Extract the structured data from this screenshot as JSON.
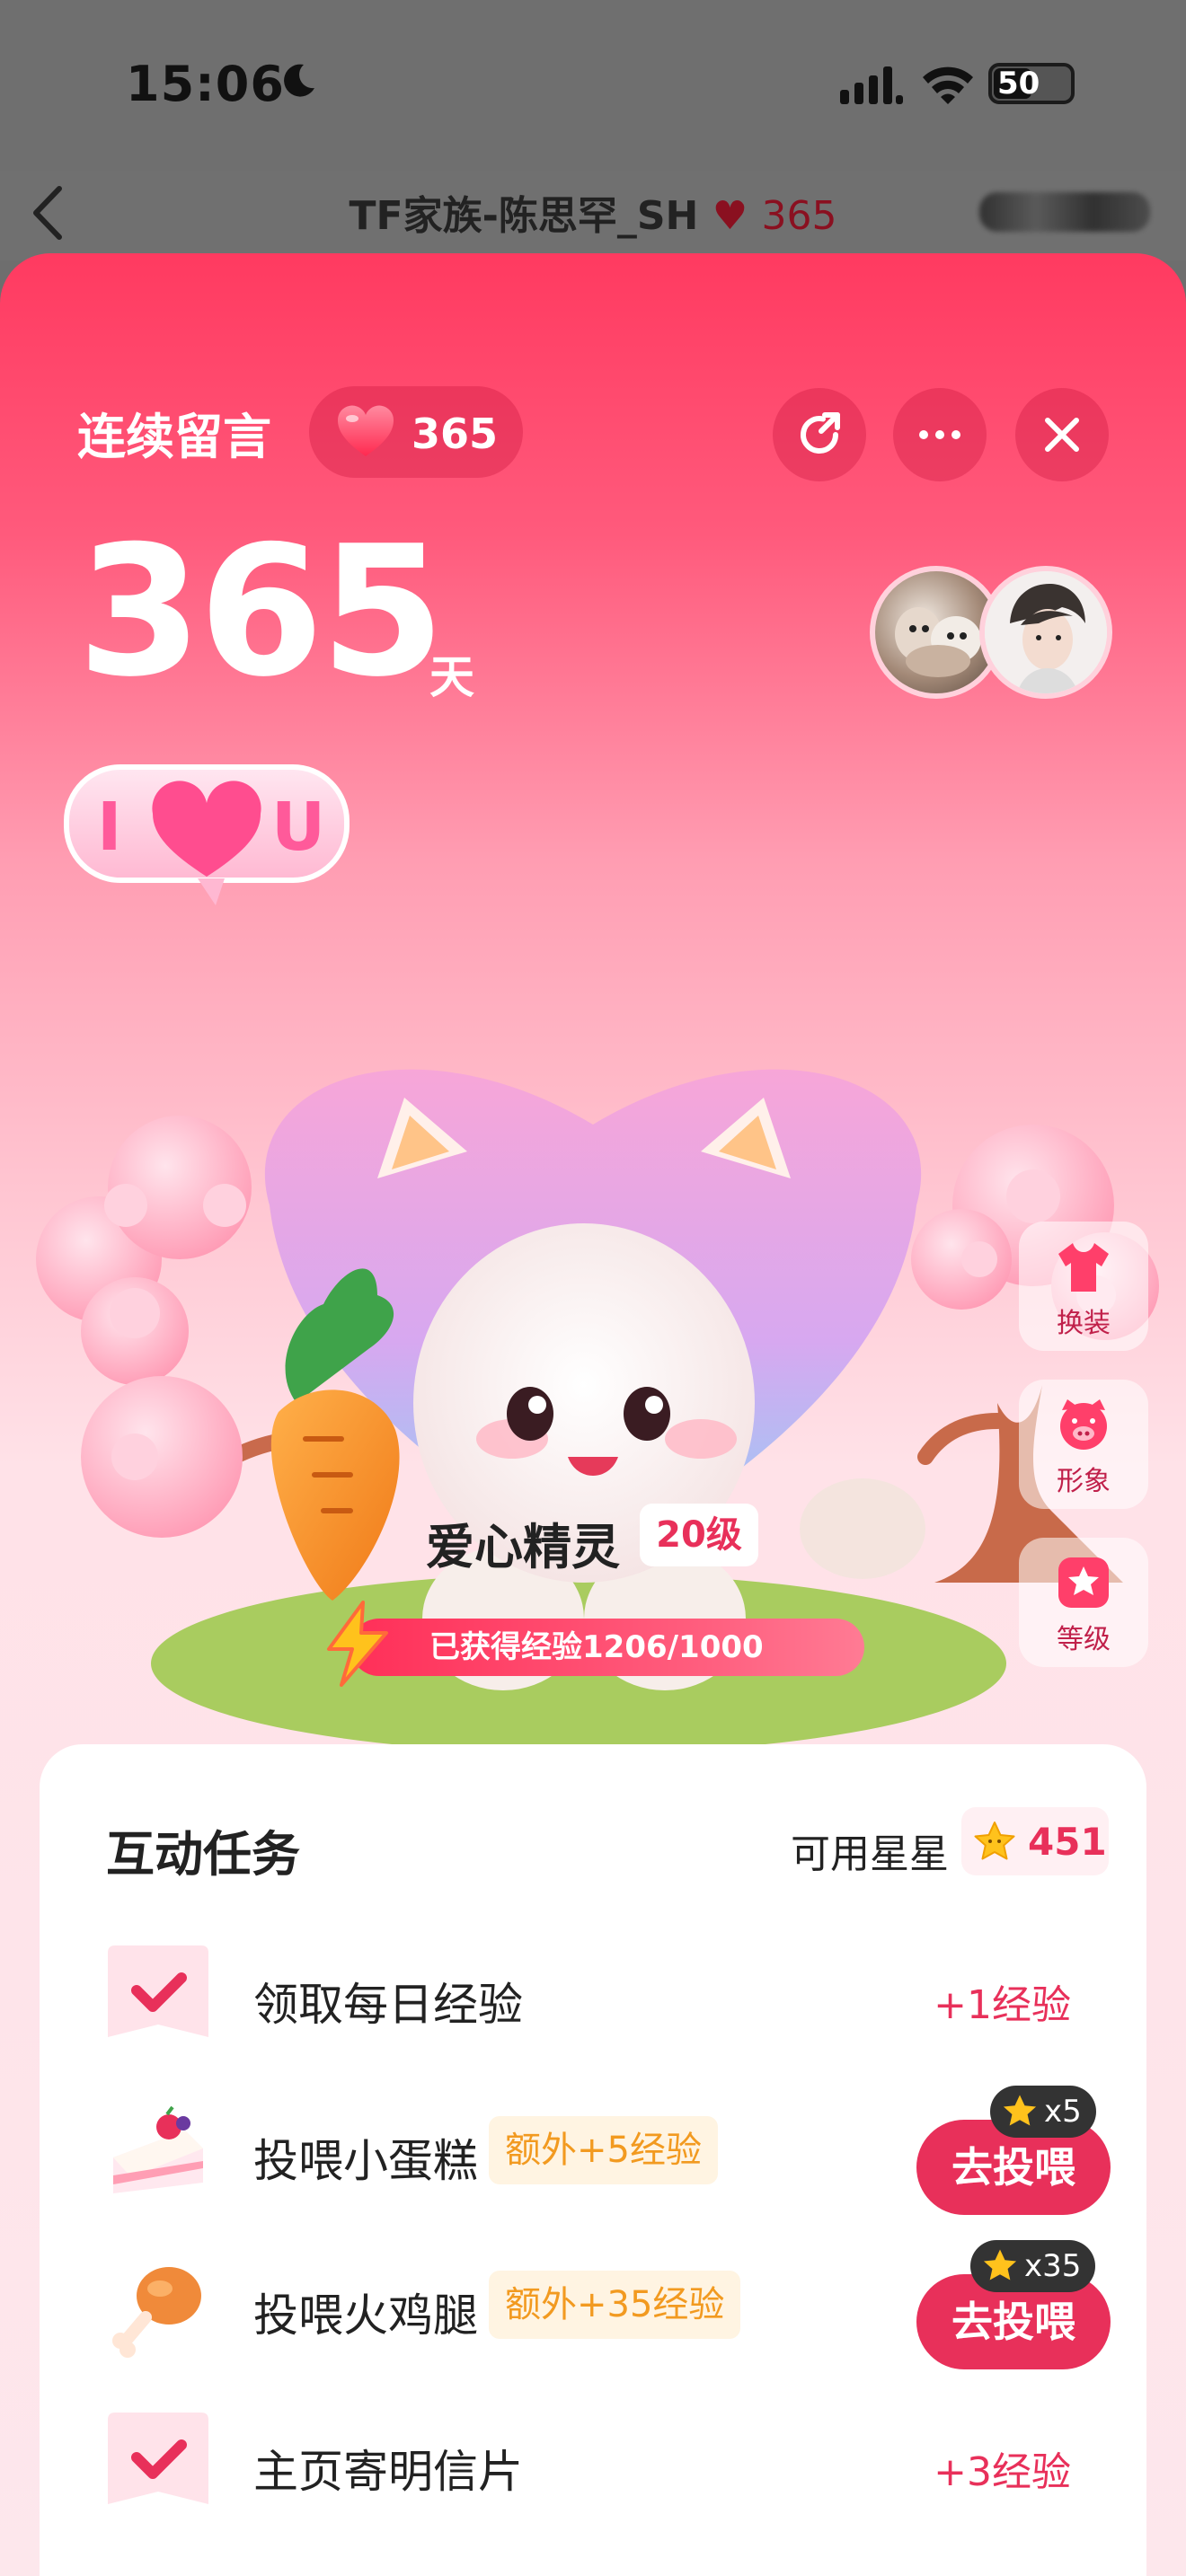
{
  "status_bar": {
    "time": "15:06",
    "battery": "50"
  },
  "nav": {
    "title": "TF家族-陈思罕_SH",
    "heart_count": "365"
  },
  "header": {
    "streak_label": "连续留言",
    "streak_pill_count": "365",
    "days_value": "365",
    "days_unit": "天"
  },
  "pet": {
    "name": "爱心精灵",
    "level": "20级",
    "xp_text": "已获得经验1206/1000",
    "bubble_text": "I U"
  },
  "side_buttons": [
    {
      "label": "换装",
      "icon": "outfit-icon"
    },
    {
      "label": "形象",
      "icon": "pig-face-icon"
    },
    {
      "label": "等级",
      "icon": "star-badge-icon"
    }
  ],
  "tasks_card": {
    "title": "互动任务",
    "stars_label": "可用星星",
    "stars_value": "451",
    "tasks": [
      {
        "label": "领取每日经验",
        "reward": "+1经验",
        "icon": "check-card-icon"
      },
      {
        "label": "投喂小蛋糕",
        "badge": "额外+5经验",
        "button": "去投喂",
        "cost": "x5",
        "icon": "cake-icon"
      },
      {
        "label": "投喂火鸡腿",
        "badge": "额外+35经验",
        "button": "去投喂",
        "cost": "x35",
        "icon": "drumstick-icon"
      },
      {
        "label": "主页寄明信片",
        "reward": "+3经验",
        "icon": "check-card-icon"
      }
    ]
  },
  "colors": {
    "accent": "#e8305a",
    "badge_text": "#f29a20",
    "top_gradient": "#ff3a60"
  }
}
